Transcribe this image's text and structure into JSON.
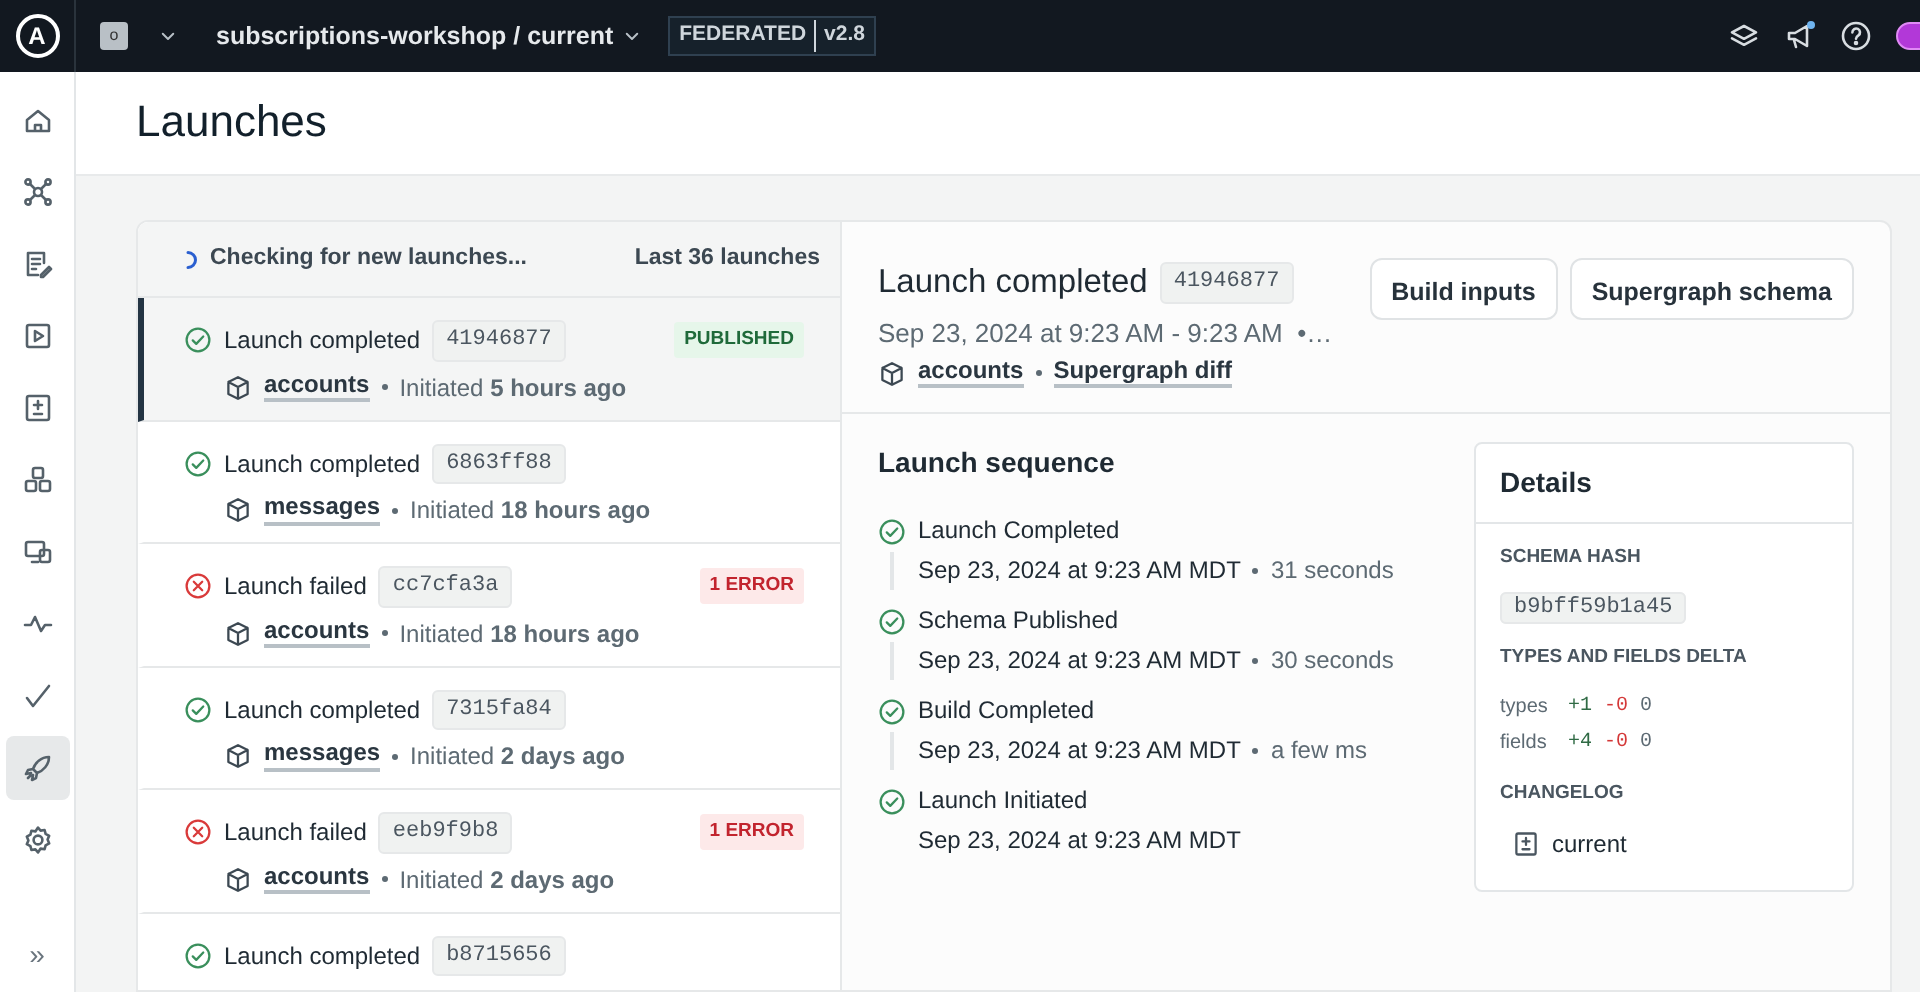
{
  "topbar": {
    "logo": "A",
    "org_initial": "o",
    "project": "subscriptions-workshop / current",
    "federation": "FEDERATED",
    "version": "v2.8",
    "notification_dot": true
  },
  "sidebar": {
    "items": [
      {
        "selected": false
      },
      {
        "selected": false
      },
      {
        "selected": false
      },
      {
        "selected": false
      },
      {
        "selected": false
      },
      {
        "selected": false
      },
      {
        "selected": false
      },
      {
        "selected": false
      },
      {
        "selected": false
      },
      {
        "selected": true
      },
      {
        "selected": false
      }
    ],
    "collapse": "»"
  },
  "page": {
    "title": "Launches"
  },
  "launch_list": {
    "status": "Checking for new launches...",
    "count": "Last 36 launches",
    "items": [
      {
        "kind": "completed",
        "title": "Launch completed",
        "hash": "41946877",
        "subgraph": "accounts",
        "initiated": "Initiated **5 hours ago**",
        "badge": {
          "kind": "success",
          "text": "PUBLISHED"
        },
        "selected": true
      },
      {
        "kind": "completed",
        "title": "Launch completed",
        "hash": "6863ff88",
        "subgraph": "messages",
        "initiated": "Initiated **18 hours ago**",
        "selected": false
      },
      {
        "kind": "failed",
        "title": "Launch failed",
        "hash": "cc7cfa3a",
        "subgraph": "accounts",
        "initiated": "Initiated **18 hours ago**",
        "badge": {
          "kind": "error",
          "text": "1 ERROR"
        },
        "selected": false
      },
      {
        "kind": "completed",
        "title": "Launch completed",
        "hash": "7315fa84",
        "subgraph": "messages",
        "initiated": "Initiated **2 days ago**",
        "selected": false
      },
      {
        "kind": "failed",
        "title": "Launch failed",
        "hash": "eeb9f9b8",
        "subgraph": "accounts",
        "initiated": "Initiated **2 days ago**",
        "badge": {
          "kind": "error",
          "text": "1 ERROR"
        },
        "selected": false
      },
      {
        "kind": "completed",
        "title": "Launch completed",
        "hash": "b8715656",
        "selected": false
      }
    ]
  },
  "launch_detail": {
    "title": "Launch completed",
    "hash": "41946877",
    "time": "Sep 23, 2024 at 9:23 AM - 9:23 AM  •…",
    "subgraph": "accounts",
    "diff_link": "Supergraph diff",
    "buttons": [
      "Build inputs",
      "Supergraph schema"
    ],
    "sequence": {
      "title": "Launch sequence",
      "steps": [
        {
          "title": "Launch Completed",
          "time": "Sep 23, 2024 at 9:23 AM MDT",
          "duration": "31 seconds"
        },
        {
          "title": "Schema Published",
          "time": "Sep 23, 2024 at 9:23 AM MDT",
          "duration": "30 seconds"
        },
        {
          "title": "Build Completed",
          "time": "Sep 23, 2024 at 9:23 AM MDT",
          "duration": "a few ms"
        },
        {
          "title": "Launch Initiated",
          "time": "Sep 23, 2024 at 9:23 AM MDT"
        }
      ]
    },
    "details": {
      "title": "Details",
      "schema_hash_label": "SCHEMA HASH",
      "schema_hash": "b9bff59b1a45",
      "delta_label": "TYPES AND FIELDS DELTA",
      "delta": [
        {
          "label": "types",
          "added": "+1",
          "removed": "-0",
          "unchanged": "0"
        },
        {
          "label": "fields",
          "added": "+4",
          "removed": "-0",
          "unchanged": "0"
        }
      ],
      "changelog_label": "CHANGELOG",
      "changelog": "current"
    }
  }
}
